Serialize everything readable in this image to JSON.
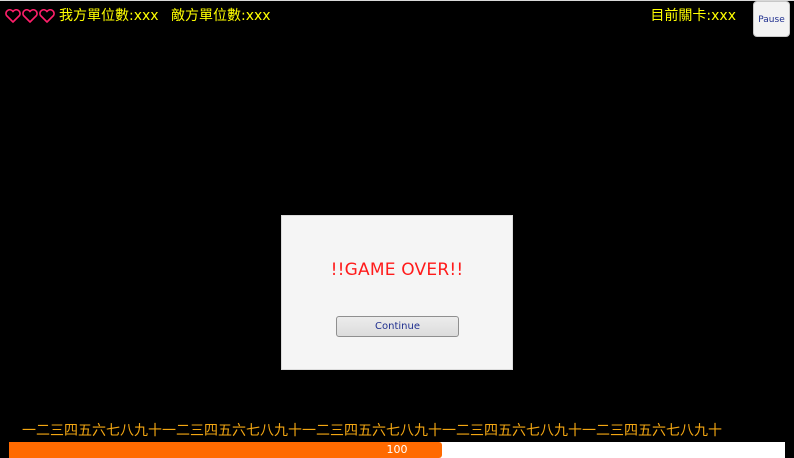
{
  "hud": {
    "hearts": [
      "heart-outline-icon",
      "heart-outline-icon",
      "heart-outline-icon"
    ],
    "heart_color": "#ff1f6a",
    "own_units_label": "我方單位數:xxx",
    "enemy_units_label": "敵方單位數:xxx",
    "current_level_label": "目前關卡:xxx",
    "text_color": "#ffff00"
  },
  "pause_button": {
    "label": "Pause"
  },
  "game_over_dialog": {
    "title": "!!GAME OVER!!",
    "continue_label": "Continue",
    "title_color": "#ff1b1b"
  },
  "ticker": {
    "text": "一二三四五六七八九十一二三四五六七八九十一二三四五六七八九十一二三四五六七八九十一二三四五六七八九十",
    "color": "#f4a712"
  },
  "progress": {
    "value_text": "100",
    "fill_fraction": 0.558,
    "fill_color": "#ff6a00"
  }
}
